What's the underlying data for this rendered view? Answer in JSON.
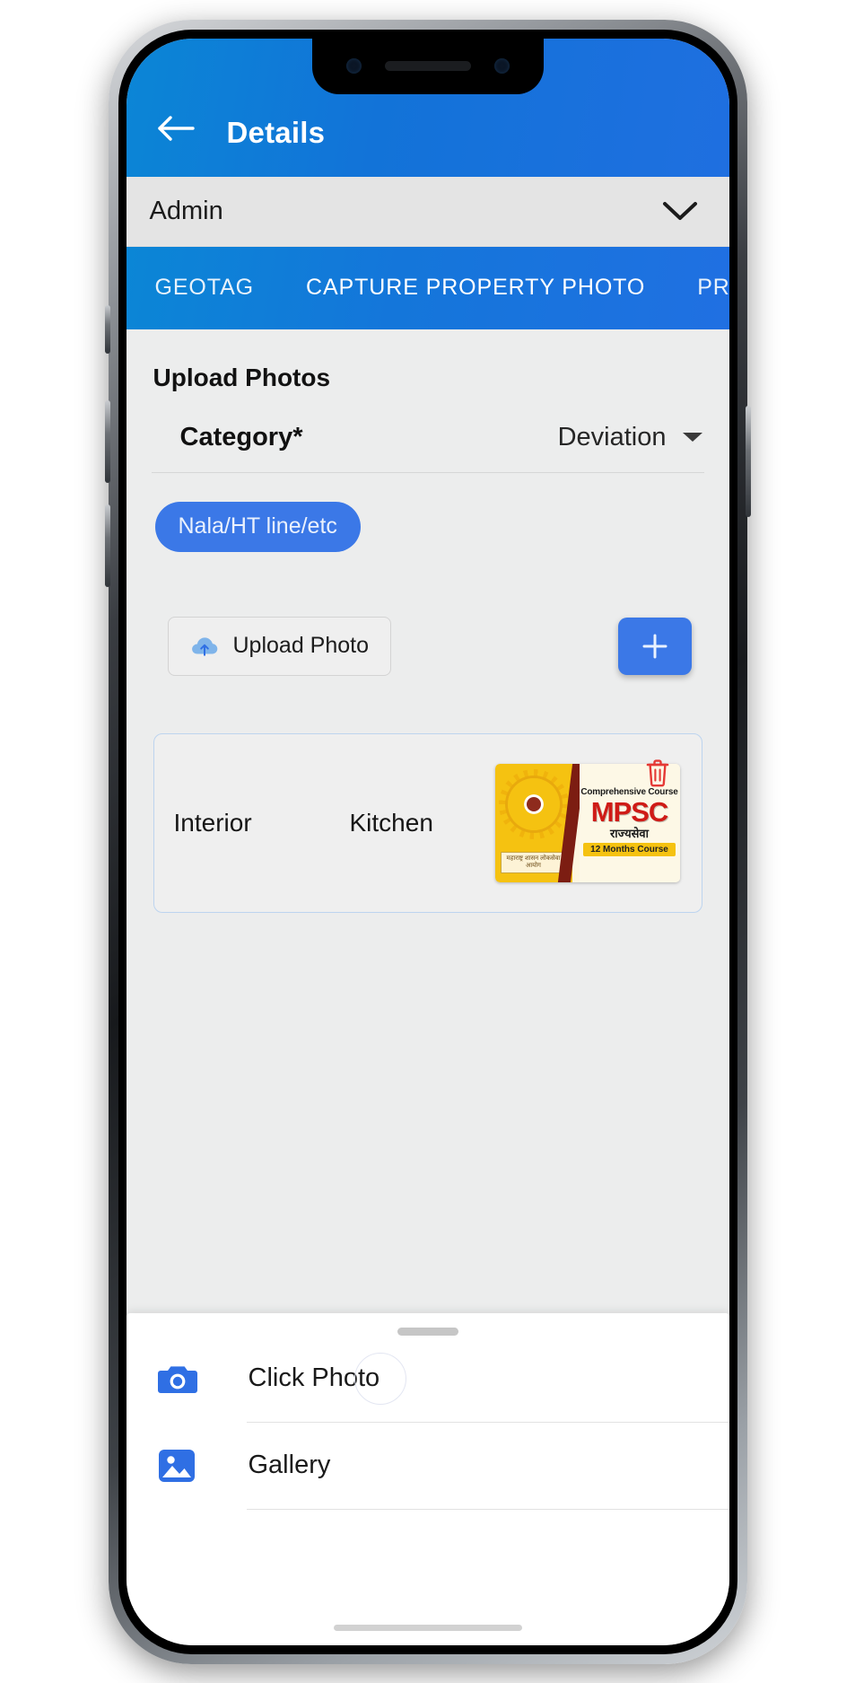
{
  "appbar": {
    "back_icon": "arrow-left-icon",
    "title": "Details",
    "background_color": "#1273d8"
  },
  "spinner": {
    "value": "Admin",
    "caret_icon": "chevron-down-icon"
  },
  "tabs": [
    {
      "label": "GEOTAG",
      "active": false
    },
    {
      "label": "CAPTURE PROPERTY PHOTO",
      "active": true
    },
    {
      "label": "PREVIEW",
      "active": false
    }
  ],
  "main": {
    "section_title": "Upload Photos",
    "category": {
      "label": "Category*",
      "value": "Deviation",
      "caret_icon": "caret-down-icon"
    },
    "chip": {
      "label": "Nala/HT line/etc",
      "color": "#3b78e7"
    },
    "upload_button": {
      "label": "Upload Photo",
      "icon": "cloud-upload-icon"
    },
    "add_button": {
      "label": "+",
      "icon": "plus-icon",
      "color": "#3b78e7"
    },
    "photo_rows": [
      {
        "col1": "Interior",
        "col2": "Kitchen",
        "thumbnail": {
          "alt": "MPSC course poster",
          "top_text": "Comprehensive Course",
          "title_text": "MPSC",
          "subtitle_text": "राज्यसेवा",
          "badge_text": "12 Months Course",
          "emblem_text": "महाराष्ट्र शासन लोकसेवा आयोग",
          "band_color": "#f5c211",
          "title_color": "#cf1b17"
        },
        "delete_icon": "trash-icon",
        "delete_color": "#e53935"
      }
    ]
  },
  "bottom_sheet": {
    "handle": "drag-handle",
    "items": [
      {
        "label": "Click Photo",
        "icon": "camera-icon",
        "icon_color": "#2f6fe4"
      },
      {
        "label": "Gallery",
        "icon": "image-icon",
        "icon_color": "#2f6fe4"
      }
    ]
  }
}
